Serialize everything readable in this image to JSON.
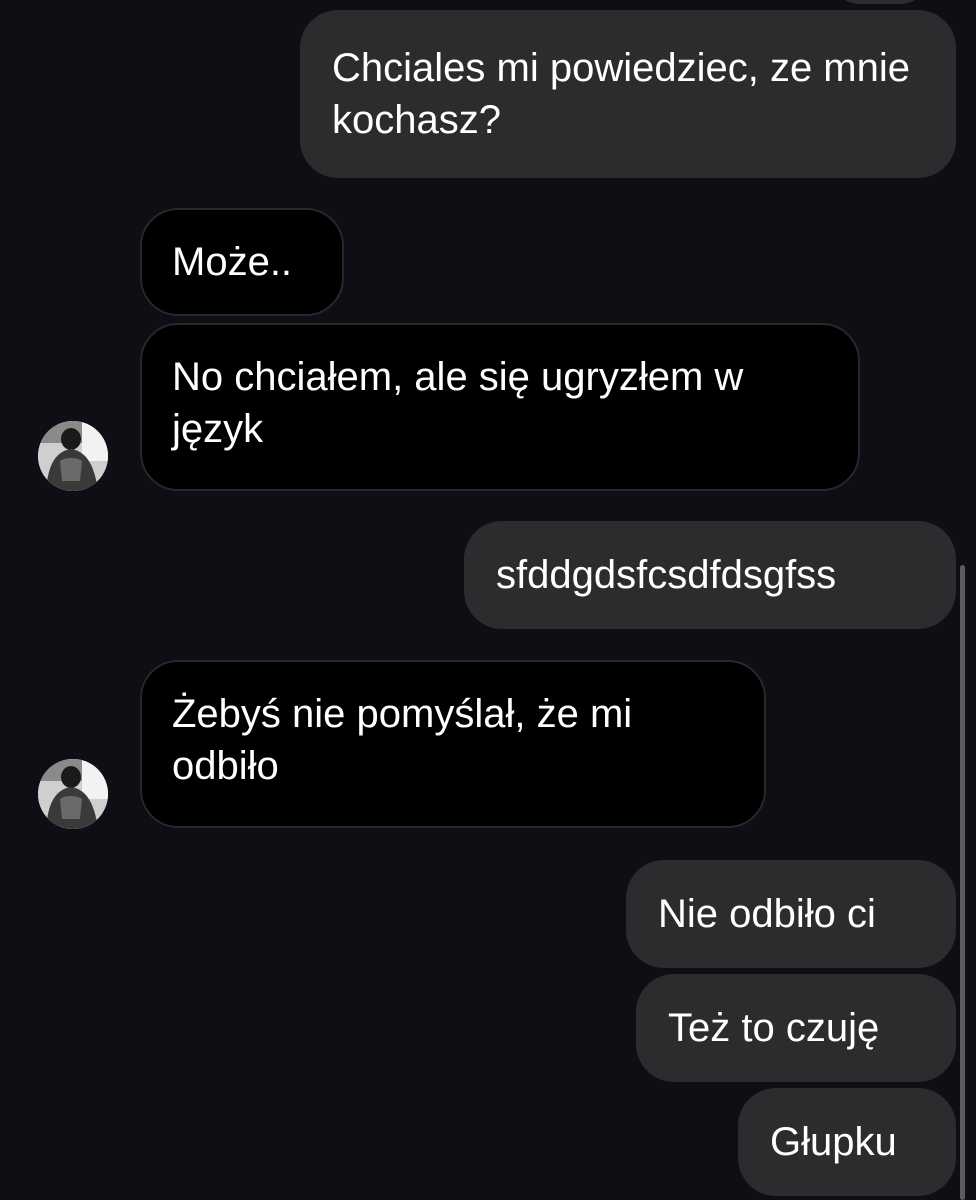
{
  "messages": [
    {
      "side": "sent",
      "text": "Chciales mi powiedziec, ze mnie kochasz?"
    },
    {
      "side": "received",
      "text": "Może.."
    },
    {
      "side": "received",
      "text": "No chciałem, ale się ugryzłem w język"
    },
    {
      "side": "sent",
      "text": "sfddgdsfcsdfdsgfss"
    },
    {
      "side": "received",
      "text": "Żebyś nie pomyślał, że mi odbiło"
    },
    {
      "side": "sent",
      "text": "Nie odbiło ci"
    },
    {
      "side": "sent",
      "text": "Też to czuję"
    },
    {
      "side": "sent",
      "text": "Głupku"
    }
  ],
  "avatar": {
    "icon": "user-avatar-photo"
  },
  "colors": {
    "background": "#0d0f14",
    "sent_bubble": "#2c2c2e",
    "received_bubble": "#000000",
    "received_border": "#26282c",
    "text": "#ffffff"
  }
}
